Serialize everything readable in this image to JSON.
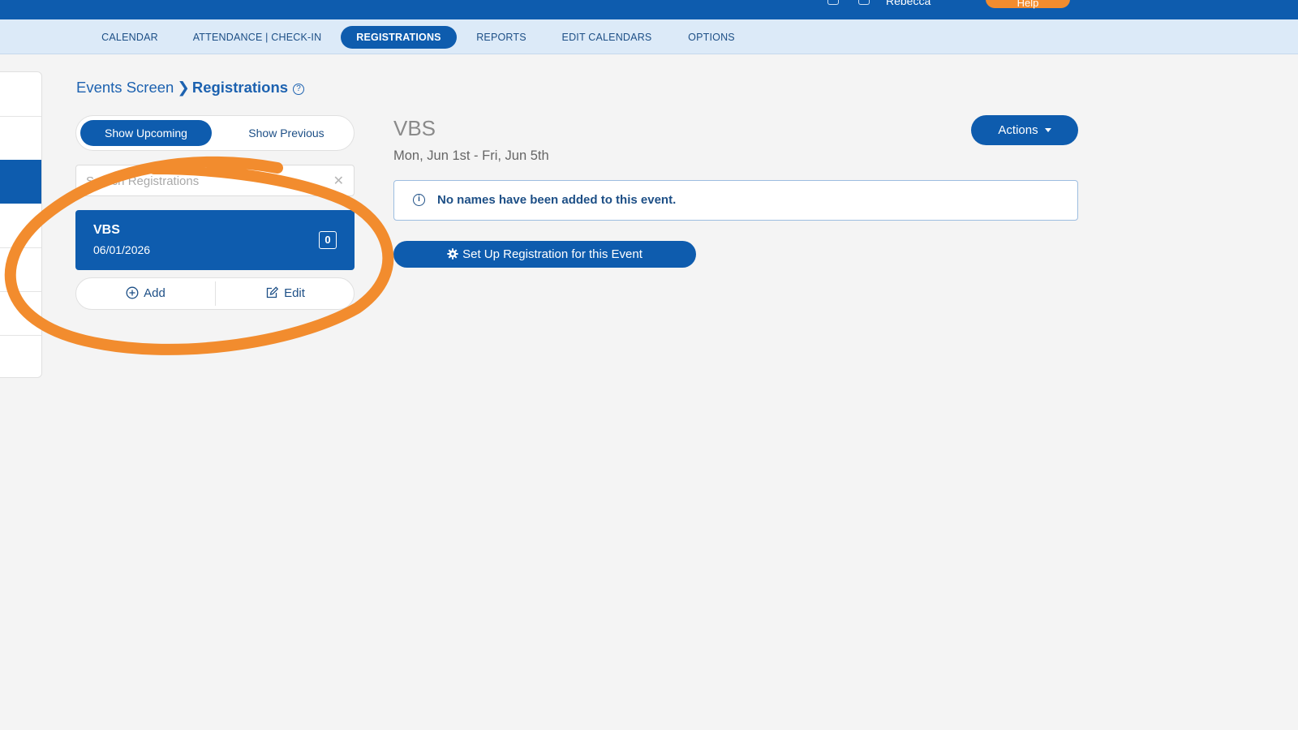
{
  "topbar": {
    "user_name": "Rebecca",
    "help_label": "Help"
  },
  "nav": {
    "tabs": [
      {
        "label": "CALENDAR",
        "active": false
      },
      {
        "label": "ATTENDANCE | CHECK-IN",
        "active": false
      },
      {
        "label": "REGISTRATIONS",
        "active": true
      },
      {
        "label": "REPORTS",
        "active": false
      },
      {
        "label": "EDIT CALENDARS",
        "active": false
      },
      {
        "label": "OPTIONS",
        "active": false
      }
    ]
  },
  "breadcrumb": {
    "parent": "Events Screen",
    "current": "Registrations",
    "help_glyph": "?"
  },
  "filter": {
    "upcoming_label": "Show Upcoming",
    "previous_label": "Show Previous",
    "selected": "Show Upcoming"
  },
  "search": {
    "placeholder": "Search Registrations",
    "value": ""
  },
  "event_list": [
    {
      "name": "VBS",
      "date": "06/01/2026",
      "count": "0"
    }
  ],
  "list_actions": {
    "add_label": "Add",
    "edit_label": "Edit"
  },
  "detail": {
    "title": "VBS",
    "dates": "Mon, Jun 1st - Fri, Jun 5th",
    "actions_label": "Actions",
    "notice": "No names have been added to this event.",
    "setup_label": "Set Up Registration for this Event"
  },
  "icons": {
    "clear": "close-icon",
    "add": "plus-circle-icon",
    "edit": "pencil-square-icon",
    "info": "info-icon",
    "setup": "gear-icon",
    "help": "question-circle-icon"
  },
  "colors": {
    "brand": "#0e5cae",
    "nav_bg": "#dceaf8",
    "annotation": "#f28c2e",
    "page_bg": "#f4f4f4"
  }
}
